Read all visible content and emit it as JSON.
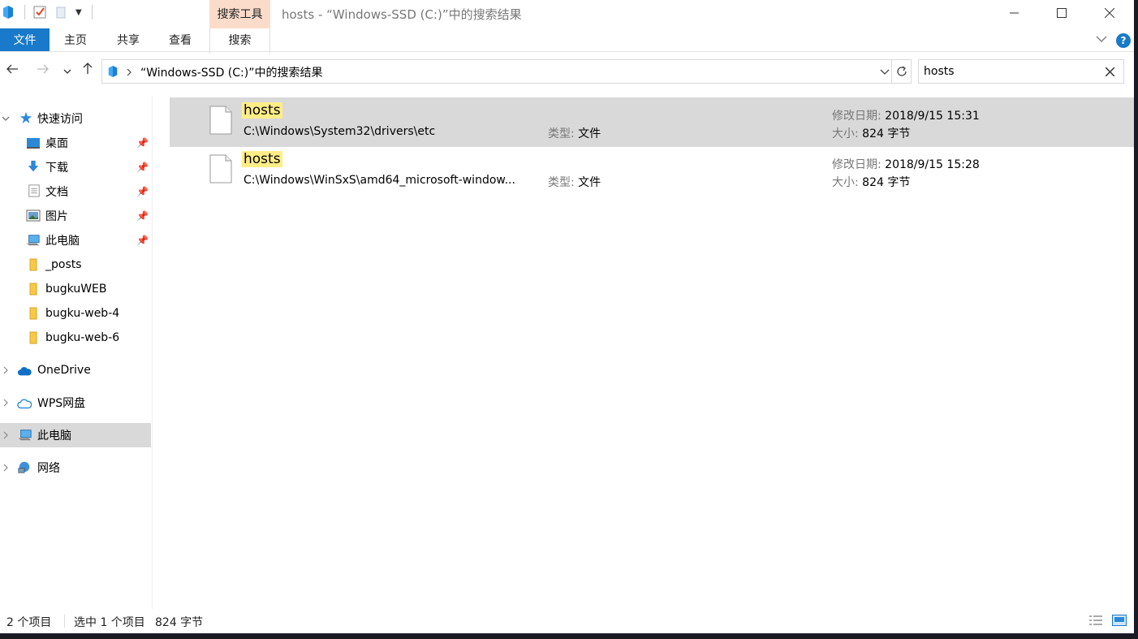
{
  "window": {
    "title": "hosts - “Windows-SSD (C:)”中的搜索结果",
    "contextual_tab_group": "搜索工具"
  },
  "ribbon": {
    "tabs": [
      {
        "label": "文件"
      },
      {
        "label": "主页"
      },
      {
        "label": "共享"
      },
      {
        "label": "查看"
      },
      {
        "label": "搜索"
      }
    ],
    "help": "?"
  },
  "address_bar": {
    "path": "“Windows-SSD (C:)”中的搜索结果"
  },
  "search": {
    "value": "hosts"
  },
  "sidebar": {
    "quick_access": "快速访问",
    "pinned": [
      {
        "label": "桌面",
        "icon": "desktop-icon"
      },
      {
        "label": "下载",
        "icon": "download-icon"
      },
      {
        "label": "文档",
        "icon": "document-icon"
      },
      {
        "label": "图片",
        "icon": "picture-icon"
      },
      {
        "label": "此电脑",
        "icon": "computer-icon"
      }
    ],
    "folders": [
      {
        "label": "_posts"
      },
      {
        "label": "bugkuWEB"
      },
      {
        "label": "bugku-web-4"
      },
      {
        "label": "bugku-web-6"
      }
    ],
    "roots": [
      {
        "label": "OneDrive",
        "icon": "onedrive-icon"
      },
      {
        "label": "WPS网盘",
        "icon": "wps-cloud-icon"
      },
      {
        "label": "此电脑",
        "icon": "computer-icon"
      },
      {
        "label": "网络",
        "icon": "network-icon"
      }
    ]
  },
  "results": [
    {
      "name": "hosts",
      "path": "C:\\Windows\\System32\\drivers\\etc",
      "type_label": "类型:",
      "type": "文件",
      "date_label": "修改日期:",
      "date": "2018/9/15 15:31",
      "size_label": "大小:",
      "size": "824 字节"
    },
    {
      "name": "hosts",
      "path": "C:\\Windows\\WinSxS\\amd64_microsoft-window...",
      "type_label": "类型:",
      "type": "文件",
      "date_label": "修改日期:",
      "date": "2018/9/15 15:28",
      "size_label": "大小:",
      "size": "824 字节"
    }
  ],
  "status": {
    "count": "2 个项目",
    "selection": "选中 1 个项目",
    "selection_size": "824 字节"
  },
  "colors": {
    "accent": "#1979ca",
    "contextual_tab": "#fbdccb",
    "highlight": "#ffee88",
    "selected_row": "#d9d9d9"
  }
}
